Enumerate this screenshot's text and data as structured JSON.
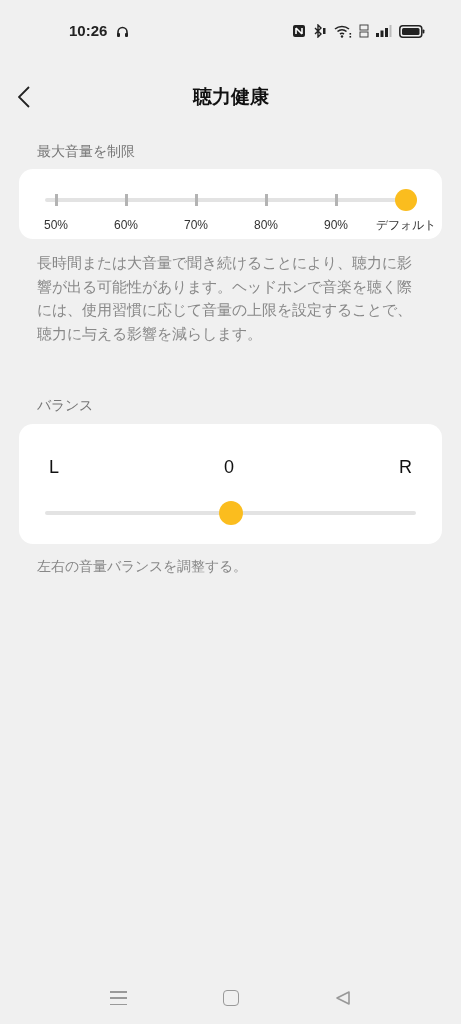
{
  "status_bar": {
    "time": "10:26"
  },
  "header": {
    "title": "聴力健康"
  },
  "volume_limit": {
    "label": "最大音量を制限",
    "steps": [
      {
        "label": "50%",
        "selected": false
      },
      {
        "label": "60%",
        "selected": false
      },
      {
        "label": "70%",
        "selected": false
      },
      {
        "label": "80%",
        "selected": false
      },
      {
        "label": "90%",
        "selected": false
      },
      {
        "label": "デフォルト",
        "selected": true
      }
    ],
    "description": "長時間または大音量で聞き続けることにより、聴力に影響が出る可能性があります。ヘッドホンで音楽を聴く際には、使用習慣に応じて音量の上限を設定することで、聴力に与える影響を減らします。"
  },
  "balance": {
    "label": "バランス",
    "left": "L",
    "value": "0",
    "right": "R",
    "level": 0.5,
    "description": "左右の音量バランスを調整する。"
  }
}
